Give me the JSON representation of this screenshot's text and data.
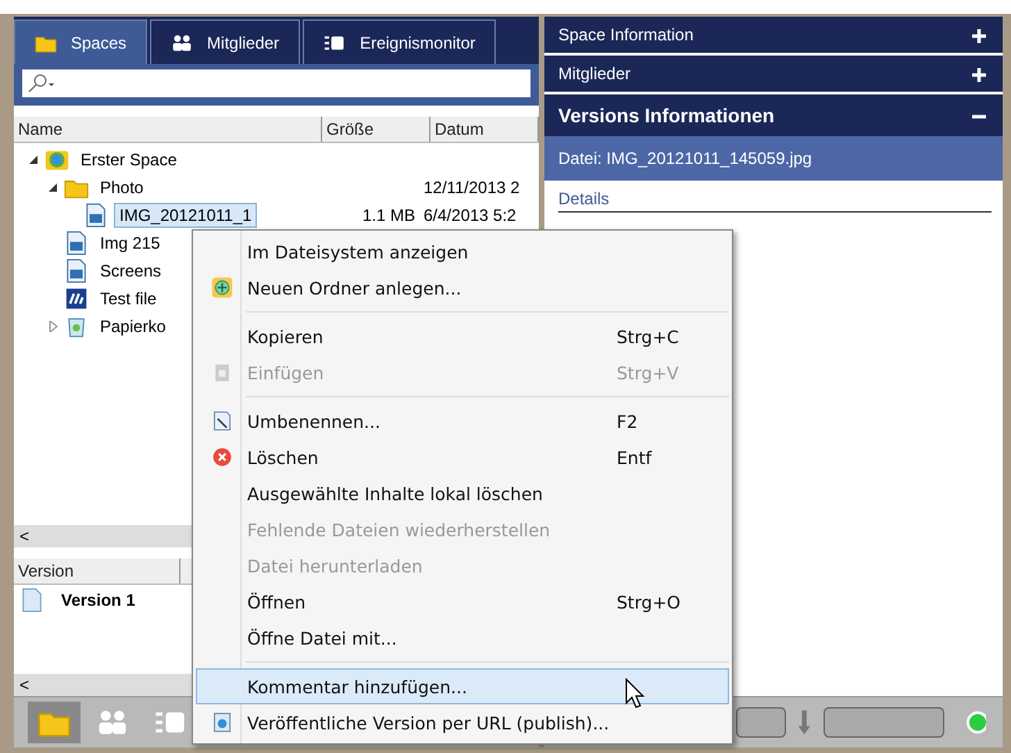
{
  "tabs": [
    {
      "label": "Spaces",
      "selected": true
    },
    {
      "label": "Mitglieder",
      "selected": false
    },
    {
      "label": "Ereignismonitor",
      "selected": false
    }
  ],
  "tree": {
    "columns": [
      "Name",
      "Größe",
      "Datum"
    ],
    "rows": [
      {
        "name": "Erster Space",
        "kind": "space",
        "expanded": true,
        "selected": false,
        "children": [
          {
            "name": "Photo",
            "kind": "folder",
            "date": "12/11/2013 2",
            "expanded": true,
            "selected": false,
            "children": [
              {
                "name": "IMG_20121011_1",
                "kind": "image",
                "size": "1.1 MB",
                "date": "6/4/2013 5:2",
                "selected": true
              }
            ]
          },
          {
            "name": "Img 215",
            "kind": "image",
            "selected": false
          },
          {
            "name": "Screens",
            "kind": "image",
            "selected": false
          },
          {
            "name": "Test file",
            "kind": "document",
            "selected": false
          },
          {
            "name": "Papierko",
            "kind": "trash",
            "expanded": false,
            "selected": false
          }
        ]
      }
    ],
    "scroll_arrow": "<"
  },
  "versions": {
    "columns": [
      "Version"
    ],
    "rows": [
      {
        "name": "Version 1",
        "selected": false
      }
    ],
    "scroll_arrow": "<"
  },
  "bottom_toolbar": [
    {
      "selected": true
    },
    {
      "selected": false
    },
    {
      "selected": false
    }
  ],
  "status_bars": [
    {
      "level": 0
    },
    {
      "level": 0
    }
  ],
  "panels": [
    {
      "title": "Space Information",
      "expanded": false
    },
    {
      "title": "Mitglieder",
      "expanded": false
    },
    {
      "title": "Versions Informationen",
      "expanded": true
    }
  ],
  "file_info": {
    "label": "Datei: IMG_20121011_145059.jpg",
    "link": "Details"
  },
  "context_menu": [
    {
      "kind": "plain",
      "label": "Im Dateisystem anzeigen",
      "disabled": false,
      "selected": false
    },
    {
      "kind": "add",
      "label": "Neuen Ordner anlegen...",
      "disabled": false,
      "selected": false
    },
    {
      "kind": "separator"
    },
    {
      "kind": "plain",
      "label": "Kopieren",
      "shortcut": "Strg+C",
      "disabled": false,
      "selected": false
    },
    {
      "kind": "paste",
      "label": "Einfügen",
      "shortcut": "Strg+V",
      "disabled": true,
      "selected": false
    },
    {
      "kind": "separator"
    },
    {
      "kind": "rename",
      "label": "Umbenennen...",
      "shortcut": "F2",
      "disabled": false,
      "selected": false
    },
    {
      "kind": "delete",
      "label": "Löschen",
      "shortcut": "Entf",
      "disabled": false,
      "selected": false
    },
    {
      "kind": "plain",
      "label": "Ausgewählte Inhalte lokal löschen",
      "disabled": false,
      "selected": false
    },
    {
      "kind": "plain",
      "label": "Fehlende Dateien wiederherstellen",
      "disabled": true,
      "selected": false
    },
    {
      "kind": "plain",
      "label": "Datei herunterladen",
      "disabled": true,
      "selected": false
    },
    {
      "kind": "plain",
      "label": "Öffnen",
      "shortcut": "Strg+O",
      "disabled": false,
      "selected": false
    },
    {
      "kind": "plain",
      "label": "Öffne Datei mit...",
      "disabled": false,
      "selected": false
    },
    {
      "kind": "separator"
    },
    {
      "kind": "plain",
      "label": "Kommentar hinzufügen...",
      "disabled": false,
      "selected": true
    },
    {
      "kind": "publish",
      "label": "Veröffentliche Version per URL (publish)...",
      "disabled": false,
      "selected": false
    }
  ]
}
